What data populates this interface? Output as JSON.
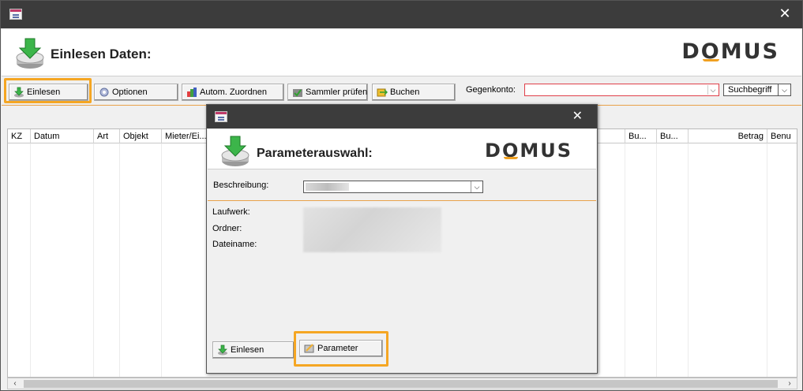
{
  "window": {
    "close_glyph": "✕",
    "header_title": "Einlesen Daten:",
    "logo_pre": "D",
    "logo_o": "O",
    "logo_post": "MUS"
  },
  "toolbar": {
    "buttons": [
      {
        "label": "Einlesen",
        "icon": "download-arrow-icon",
        "highlighted": true
      },
      {
        "label": "Optionen",
        "icon": "gear-icon"
      },
      {
        "label": "Autom. Zuordnen",
        "icon": "auto-assign-icon"
      },
      {
        "label": "Sammler prüfen",
        "icon": "check-folder-icon"
      },
      {
        "label": "Buchen",
        "icon": "book-entry-icon"
      }
    ],
    "gegenkonto_label": "Gegenkonto:",
    "gegenkonto_value": "",
    "suchbegriff_value": "Suchbegriff"
  },
  "grid": {
    "columns": [
      "KZ",
      "Datum",
      "Art",
      "Objekt",
      "Mieter/Ei...",
      "Bu...",
      "Bu...",
      "Betrag",
      "Benu"
    ],
    "rows": []
  },
  "dialog": {
    "close_glyph": "✕",
    "header_title": "Parameterauswahl:",
    "beschreibung_label": "Beschreibung:",
    "laufwerk_label": "Laufwerk:",
    "ordner_label": "Ordner:",
    "dateiname_label": "Dateiname:",
    "buttons": [
      {
        "label": "Einlesen",
        "icon": "download-arrow-icon"
      },
      {
        "label": "Parameter",
        "icon": "parameter-icon",
        "highlighted": true
      }
    ]
  },
  "colors": {
    "titlebar": "#3c3c3c",
    "accent_orange": "#f5a623",
    "separator": "#e8a14a",
    "required_red": "#e0404a"
  }
}
